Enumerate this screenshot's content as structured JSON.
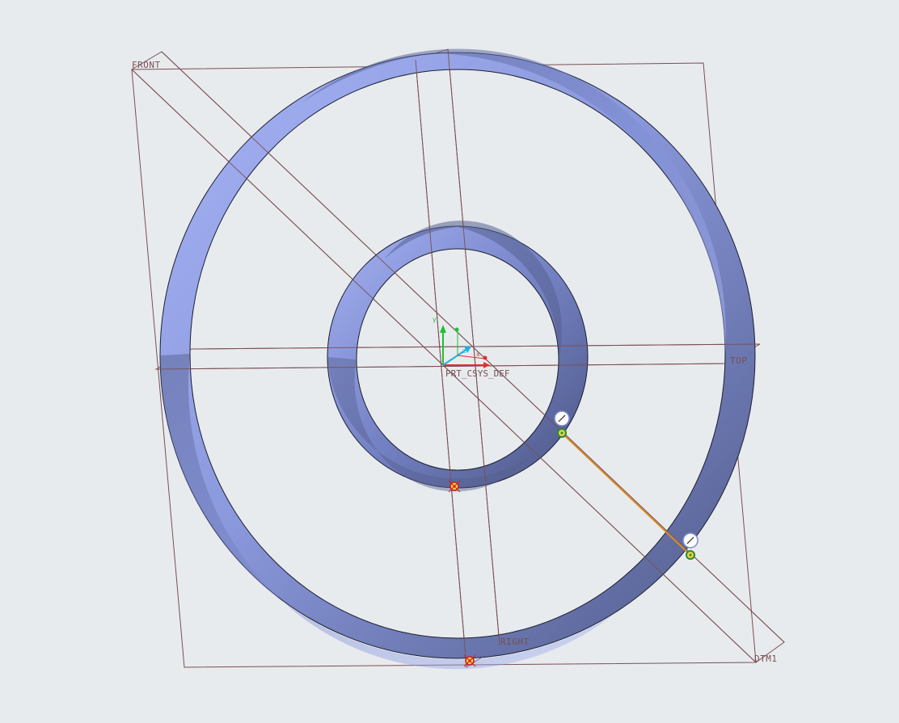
{
  "viewport": {
    "background": "#e8ebee"
  },
  "datum_planes": {
    "front": "FRONT",
    "top": "TOP",
    "right": "RIGHT",
    "dtm1": "DTM1"
  },
  "csys": {
    "name": "PRT_CSYS_DEF",
    "axis_x": "x",
    "axis_y": "y",
    "axis_z": "z"
  },
  "colors": {
    "plane_edge": "#7a4e52",
    "surface_light": "#a3b1f4",
    "surface_dark": "#55608f",
    "sketch_line": "#f0a020",
    "endpoint_ring": "#2a8a3a",
    "selected_vertex": "#d02020",
    "axis_x_color": "#e03030",
    "axis_y_color": "#20c030",
    "axis_z_color": "#20b0e0"
  },
  "icons": {
    "dimension_handle": "ruler-handle-icon",
    "vertex_marker": "vertex-marker-icon"
  }
}
